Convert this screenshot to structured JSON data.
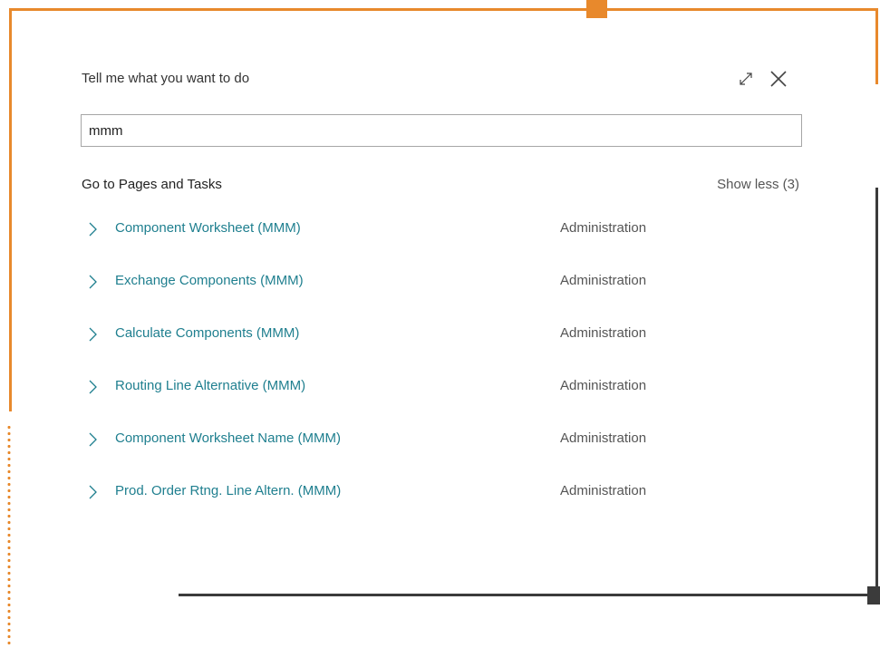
{
  "dialog": {
    "title": "Tell me what you want to do",
    "icons": {
      "expand": "expand-diagonal-icon",
      "close": "close-icon"
    }
  },
  "search": {
    "value": "mmm",
    "placeholder": ""
  },
  "section": {
    "title": "Go to Pages and Tasks",
    "toggle_label": "Show less (3)"
  },
  "results": [
    {
      "name": "Component Worksheet (MMM)",
      "category": "Administration"
    },
    {
      "name": "Exchange Components (MMM)",
      "category": "Administration"
    },
    {
      "name": "Calculate Components (MMM)",
      "category": "Administration"
    },
    {
      "name": "Routing Line Alternative (MMM)",
      "category": "Administration"
    },
    {
      "name": "Component Worksheet Name (MMM)",
      "category": "Administration"
    },
    {
      "name": "Prod. Order Rtng. Line Altern. (MMM)",
      "category": "Administration"
    }
  ],
  "colors": {
    "accent": "#e8892c",
    "frame_dark": "#3b3b3b",
    "link": "#1f7f8f"
  }
}
